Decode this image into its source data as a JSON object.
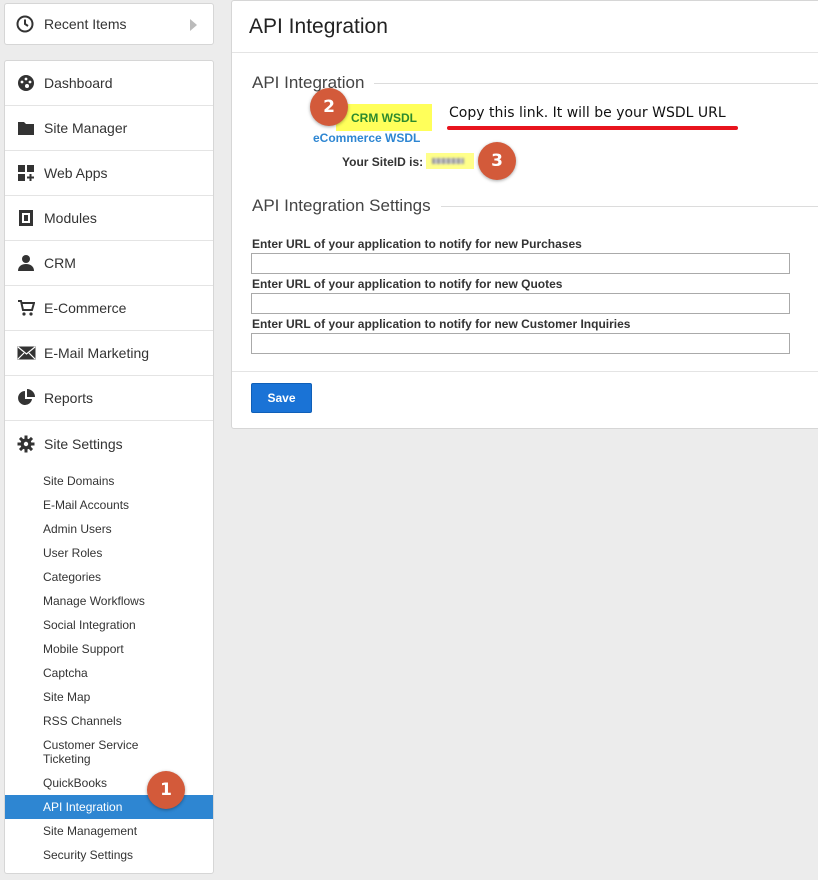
{
  "recent": {
    "label": "Recent Items"
  },
  "nav": {
    "items": [
      {
        "label": "Dashboard",
        "icon": "dashboard-icon"
      },
      {
        "label": "Site Manager",
        "icon": "folder-icon"
      },
      {
        "label": "Web Apps",
        "icon": "web-apps-icon"
      },
      {
        "label": "Modules",
        "icon": "modules-icon"
      },
      {
        "label": "CRM",
        "icon": "user-icon"
      },
      {
        "label": "E-Commerce",
        "icon": "cart-icon"
      },
      {
        "label": "E-Mail Marketing",
        "icon": "envelope-icon"
      },
      {
        "label": "Reports",
        "icon": "pie-chart-icon"
      },
      {
        "label": "Site Settings",
        "icon": "gear-icon"
      }
    ],
    "site_settings_sub": [
      "Site Domains",
      "E-Mail Accounts",
      "Admin Users",
      "User Roles",
      "Categories",
      "Manage Workflows",
      "Social Integration",
      "Mobile Support",
      "Captcha",
      "Site Map",
      "RSS Channels",
      "Customer Service Ticketing",
      "QuickBooks",
      "API Integration",
      "Site Management",
      "Security Settings"
    ]
  },
  "main": {
    "title": "API Integration",
    "section1": "API Integration",
    "crm_wsdl": "CRM WSDL",
    "ecommerce_wsdl": "eCommerce WSDL",
    "note": "Copy this link. It will be your WSDL URL",
    "siteid_label": "Your SiteID is:",
    "section2": "API Integration Settings",
    "field_purchases": "Enter URL of your application to notify for new Purchases",
    "field_quotes": "Enter URL of your application to notify for new Quotes",
    "field_inquiries": "Enter URL of your application to notify for new Customer Inquiries",
    "save": "Save"
  },
  "badges": {
    "one": "1",
    "two": "2",
    "three": "3"
  },
  "colors": {
    "accent": "#2e86d2",
    "highlight": "#ffff5a",
    "annotation_red": "#e8141d",
    "badge": "#d35a3a"
  }
}
